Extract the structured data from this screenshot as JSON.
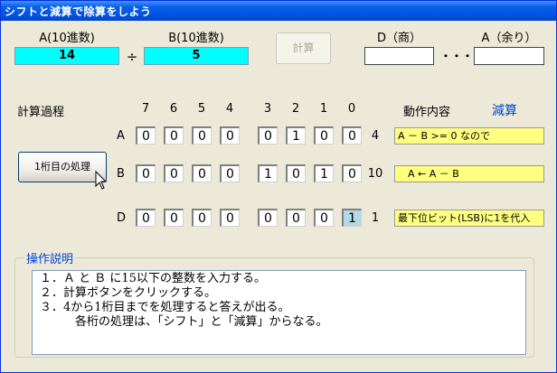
{
  "window": {
    "title": "シフトと減算で除算をしよう"
  },
  "inputs": {
    "a_label": "A(10進数)",
    "a_value": "14",
    "div_sign": "÷",
    "b_label": "B(10進数)",
    "b_value": "5",
    "calc_button": "計算",
    "d_label": "D（商）",
    "d_value": "",
    "ellipsis": "・・・",
    "rem_label": "A（余り）",
    "rem_value": ""
  },
  "process": {
    "title": "計算過程",
    "bit_headers": [
      "7",
      "6",
      "5",
      "4",
      "3",
      "2",
      "1",
      "0"
    ],
    "action_header": "動作内容",
    "mode": "減算",
    "step_button": "1桁目の処理",
    "rows": [
      {
        "name": "A",
        "bits": [
          "0",
          "0",
          "0",
          "0",
          "0",
          "1",
          "0",
          "0"
        ],
        "decimal": "4",
        "action": "A － B >= 0 なので"
      },
      {
        "name": "B",
        "bits": [
          "0",
          "0",
          "0",
          "0",
          "1",
          "0",
          "1",
          "0"
        ],
        "decimal": "10",
        "action": "A ← A － B"
      },
      {
        "name": "D",
        "bits": [
          "0",
          "0",
          "0",
          "0",
          "0",
          "0",
          "0",
          "1"
        ],
        "decimal": "1",
        "action": "最下位ビット(LSB)に1を代入"
      }
    ]
  },
  "help": {
    "legend": "操作説明",
    "lines": [
      "１．Ａ と Ｂ に15以下の整数を入力する。",
      "２．計算ボタンをクリックする。",
      "３．4から1桁目までを処理すると答えが出る。",
      "",
      "　　　各桁の処理は、「シフト」と「減算」からなる。"
    ]
  },
  "colors": {
    "input_bg": "#00FFFF",
    "action_bg": "#FFFF80",
    "highlight_bit": "#B3DAE8",
    "mode_text": "#0046D5"
  }
}
